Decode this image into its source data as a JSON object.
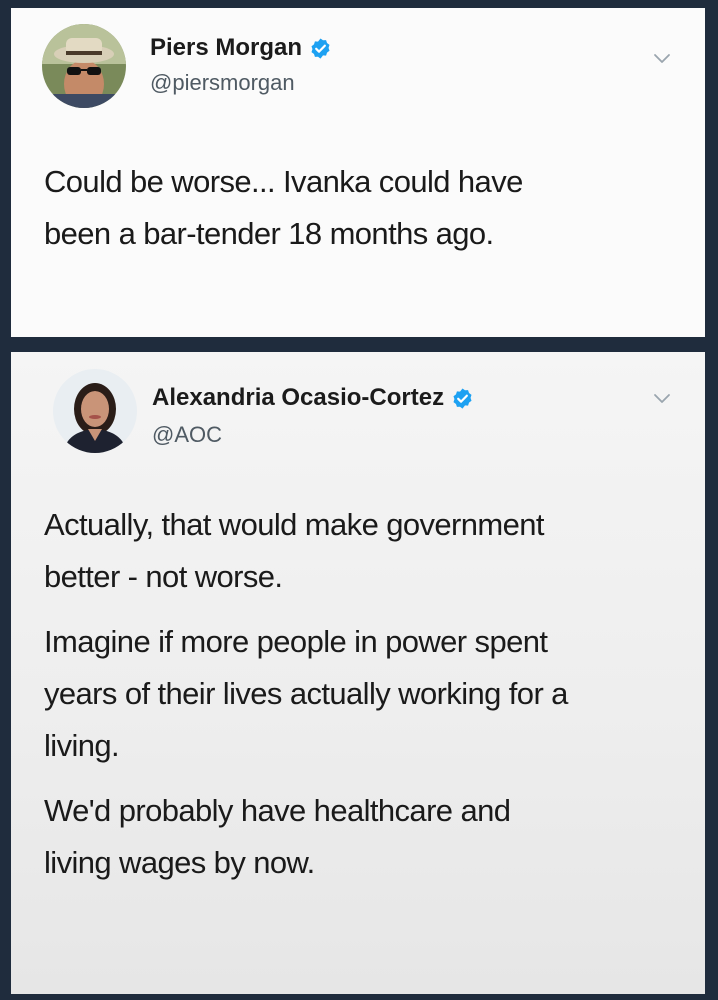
{
  "tweets": [
    {
      "name": "Piers Morgan",
      "handle": "@piersmorgan",
      "verified": true,
      "avatar_icon": "piers-morgan-avatar",
      "paragraphs": [
        [
          "Could be worse... Ivanka could have",
          "been a bar-tender 18 months ago."
        ]
      ]
    },
    {
      "name": "Alexandria Ocasio-Cortez",
      "handle": "@AOC",
      "verified": true,
      "avatar_icon": "aoc-avatar",
      "paragraphs": [
        [
          "Actually, that would make government",
          "better - not worse."
        ],
        [
          "Imagine if more people in power spent",
          "years of their lives actually working for a",
          "living."
        ],
        [
          "We'd probably have healthcare and",
          "living wages by now."
        ]
      ]
    }
  ],
  "colors": {
    "background": "#1f2c3d",
    "verified_badge": "#1da1f2",
    "handle_text": "#4f5a63"
  },
  "icons": {
    "verified": "verified-badge-icon",
    "menu": "chevron-down-icon"
  }
}
